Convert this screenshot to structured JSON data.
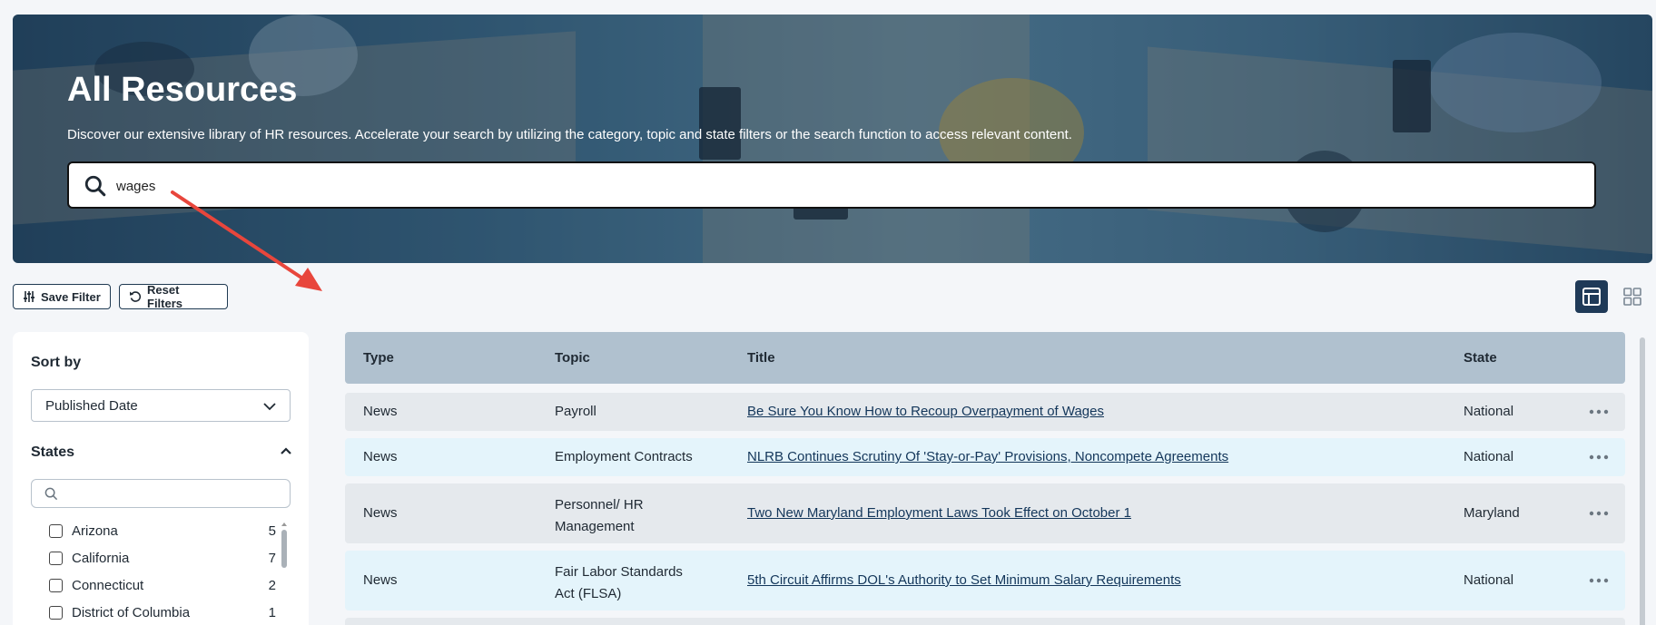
{
  "hero": {
    "title": "All Resources",
    "description": "Discover our extensive library of HR resources. Accelerate your search by utilizing the category, topic and state filters or the search function to access relevant content.",
    "search_value": "wages"
  },
  "toolbar": {
    "save_filter_label": "Save Filter",
    "reset_filters_label": "Reset Filters",
    "view_modes": [
      "table-view-icon",
      "grid-view-icon"
    ],
    "active_view": "table"
  },
  "sidebar": {
    "sort_label": "Sort by",
    "sort_value": "Published Date",
    "states_label": "States",
    "states_search_placeholder": "",
    "states": [
      {
        "name": "Arizona",
        "count": "5"
      },
      {
        "name": "California",
        "count": "7"
      },
      {
        "name": "Connecticut",
        "count": "2"
      },
      {
        "name": "District of Columbia",
        "count": "1"
      }
    ]
  },
  "table": {
    "headers": {
      "type": "Type",
      "topic": "Topic",
      "title": "Title",
      "state": "State"
    },
    "rows": [
      {
        "type": "News",
        "topic": "Payroll",
        "title": "Be Sure You Know How to Recoup Overpayment of Wages",
        "state": "National"
      },
      {
        "type": "News",
        "topic": "Employment Contracts",
        "title": "NLRB Continues Scrutiny Of 'Stay-or-Pay' Provisions, Noncompete Agreements",
        "state": "National"
      },
      {
        "type": "News",
        "topic_line1": "Personnel/ HR",
        "topic_line2": "Management",
        "title": "Two New Maryland Employment Laws Took Effect on October 1",
        "state": "Maryland"
      },
      {
        "type": "News",
        "topic_line1": "Fair Labor Standards",
        "topic_line2": "Act (FLSA)",
        "title": "5th Circuit Affirms DOL's Authority to Set Minimum Salary Requirements",
        "state": "National"
      }
    ]
  },
  "colors": {
    "accent_dark": "#1f3a58",
    "header_bg": "#b0c1cf",
    "row_gray": "#e5e9ed",
    "row_blue": "#e4f4fb",
    "link": "#13365a",
    "annotation_arrow": "#e8463c"
  }
}
